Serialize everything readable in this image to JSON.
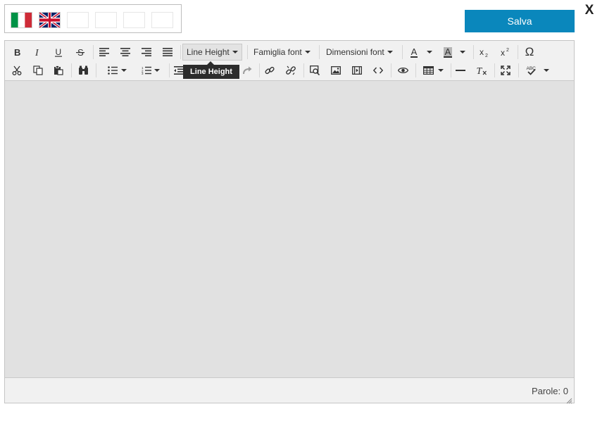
{
  "languages": {
    "items": [
      {
        "code": "it",
        "name": "italian-flag"
      },
      {
        "code": "en",
        "name": "uk-flag"
      }
    ],
    "empty_slots": 4
  },
  "header": {
    "save_label": "Salva",
    "close_label": "X"
  },
  "toolbar": {
    "row1": {
      "line_height_label": "Line Height",
      "font_family_label": "Famiglia font",
      "font_size_label": "Dimensioni font",
      "font_color_glyph": "A",
      "bg_color_glyph": "A",
      "special_char_glyph": "Ω"
    },
    "icons": [
      "bold-icon",
      "italic-icon",
      "underline-icon",
      "strikethrough-icon",
      "align-left-icon",
      "align-center-icon",
      "align-right-icon",
      "align-justify-icon",
      "subscript-icon",
      "superscript-icon",
      "special-character-icon",
      "cut-icon",
      "copy-icon",
      "paste-icon",
      "find-replace-icon",
      "bullet-list-icon",
      "numbered-list-icon",
      "outdent-icon",
      "redo-icon",
      "link-icon",
      "unlink-icon",
      "search-image-icon",
      "image-icon",
      "media-icon",
      "code-icon",
      "preview-icon",
      "table-icon",
      "horizontal-rule-icon",
      "clear-format-icon",
      "fullscreen-icon",
      "spellcheck-icon"
    ]
  },
  "tooltip": {
    "text": "Line Height"
  },
  "status": {
    "word_count": "Parole: 0"
  },
  "colors": {
    "accent": "#0a87bc",
    "toolbar_bg": "#f1f1f1",
    "content_bg": "#e1e1e1",
    "tooltip_bg": "#2c2c2c"
  }
}
